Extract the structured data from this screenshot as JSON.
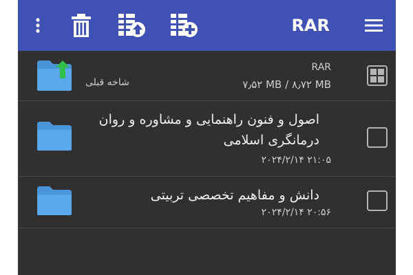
{
  "app": {
    "title": "RAR"
  },
  "toolbar": {
    "icons": [
      "more-vert-icon",
      "trash-icon",
      "archive-extract-icon",
      "archive-add-icon",
      "menu-icon"
    ]
  },
  "parent_row": {
    "label": "شاخه قبلی",
    "archive_name": "RAR",
    "storage": "۷٫۵۲ MB / ۸٫۷۲ MB"
  },
  "items": [
    {
      "name": "اصول و فنون راهنمایی و مشاوره و روان درمانگری اسلامی",
      "date": "۲۰۲۴/۲/۱۴ ۲۱:۰۵"
    },
    {
      "name": "دانش و مفاهیم تخصصی تربیتی",
      "date": "۲۰۲۴/۲/۱۴ ۲۰:۵۶"
    }
  ],
  "colors": {
    "toolbar": "#3f51b5",
    "background": "#303030",
    "folder": "#5aa9ec",
    "up_arrow": "#2fbf4a"
  }
}
